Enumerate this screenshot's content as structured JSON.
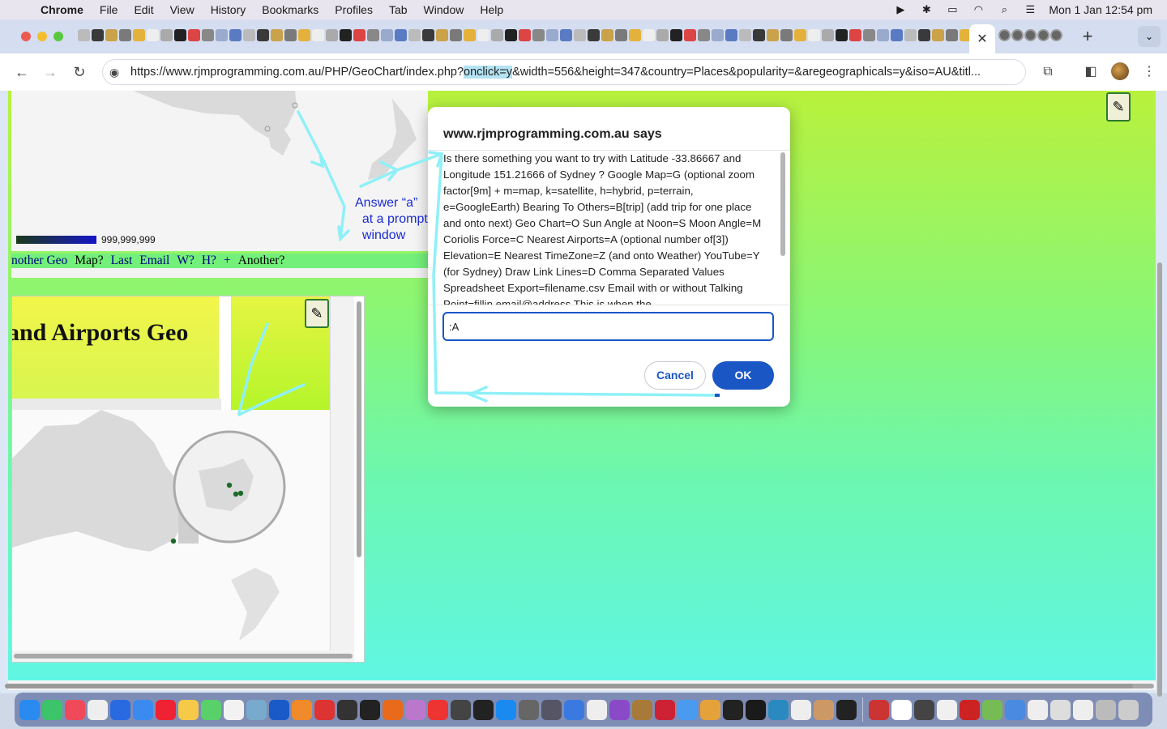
{
  "menubar": {
    "app_name": "Chrome",
    "items": [
      "File",
      "Edit",
      "View",
      "History",
      "Bookmarks",
      "Profiles",
      "Tab",
      "Window",
      "Help"
    ],
    "clock": "Mon 1 Jan  12:54 pm"
  },
  "browser": {
    "url_before": "https://www.rjmprogramming.com.au/PHP/GeoChart/index.php?",
    "url_highlight": "onclick=y",
    "url_after": "&width=556&height=347&country=Places&popularity=&aregeographicals=y&iso=AU&titl...",
    "active_tab_close": "✕",
    "new_tab": "+"
  },
  "page": {
    "legend_value": "999,999,999",
    "links": [
      "nother Geo",
      "Map?",
      "Last",
      "Email",
      "W?",
      "H?",
      "+",
      "Another?"
    ],
    "iframe_title": "and Airports Geo"
  },
  "dialog": {
    "title": "www.rjmprogramming.com.au says",
    "message": "Is there something you want to try with Latitude -33.86667 and Longitude 151.21666 of Sydney ?   Google Map=G (optional zoom factor[9m] + m=map, k=satellite, h=hybrid, p=terrain, e=GoogleEarth) Bearing To Others=B[trip] (add trip for one place and onto next) Geo Chart=O Sun Angle at Noon=S Moon Angle=M Coriolis Force=C Nearest Airports=A (optional number of[3]) Elevation=E Nearest TimeZone=Z (and onto Weather) YouTube=Y (for Sydney) Draw Link Lines=D  Comma Separated Values Spreadsheet Export=filename.csv  Email with or without Talking Point=fillin.email@address This is when the",
    "input_value": ":A",
    "cancel_label": "Cancel",
    "ok_label": "OK"
  },
  "annotation": {
    "text": "Answer “a”\n  at a prompt\n  window",
    "color": "#1a2bd0",
    "arrow_color": "#8ff0f8"
  },
  "colors": {
    "accent": "#1a56c4",
    "link": "#000080",
    "map_marker": "#1e6a2a"
  }
}
